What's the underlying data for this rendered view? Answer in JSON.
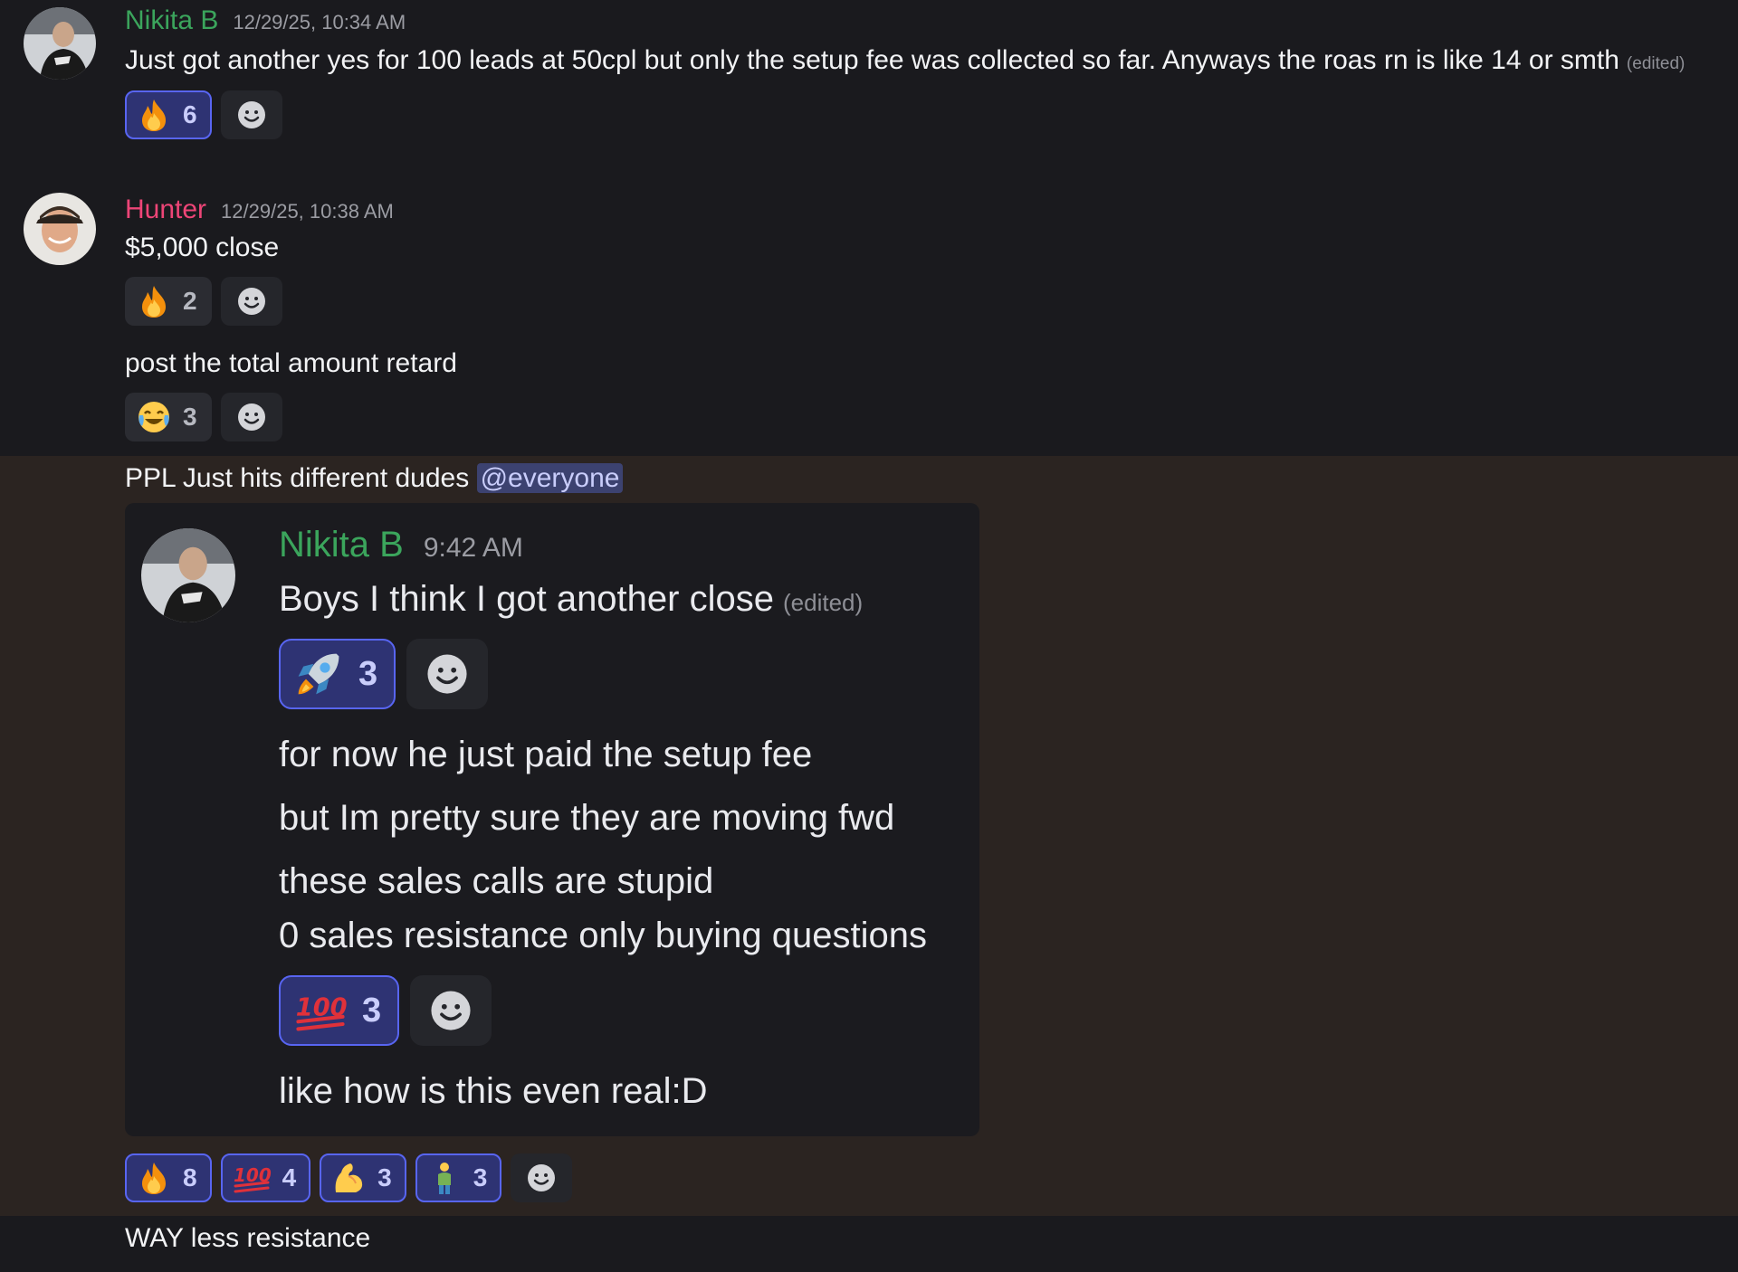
{
  "messages": [
    {
      "author": "Nikita B",
      "author_color": "#3ba55c",
      "timestamp": "12/29/25, 10:34 AM",
      "text": "Just got another yes for 100 leads at 50cpl but only the setup fee was collected so far. Anyways the roas rn is like 14 or smth",
      "edited": "(edited)",
      "reactions": [
        {
          "emoji": "fire-emoji",
          "count": "6",
          "me": true
        }
      ]
    },
    {
      "author": "Hunter",
      "author_color": "#ed4577",
      "timestamp": "12/29/25, 10:38 AM",
      "text": "$5,000 close",
      "reactions": [
        {
          "emoji": "fire-emoji",
          "count": "2",
          "me": false
        }
      ],
      "followups": [
        {
          "text": "post the total amount retard",
          "reactions": [
            {
              "emoji": "joy-emoji",
              "count": "3",
              "me": false
            }
          ]
        },
        {
          "text": "PPL Just hits different dudes",
          "mention": "@everyone",
          "embedded_screenshot": {
            "author": "Nikita B",
            "author_color": "#3ba55c",
            "timestamp": "9:42 AM",
            "line1": "Boys I think I got another close",
            "edited": "(edited)",
            "reactions1": [
              {
                "emoji": "rocket-emoji",
                "count": "3",
                "me": true
              }
            ],
            "line2": "for now he just paid the setup fee",
            "line3": "but Im pretty sure they are moving fwd",
            "line4": "these sales calls are stupid",
            "line5": "0 sales resistance only buying questions",
            "reactions2": [
              {
                "emoji": "hundred-emoji",
                "count": "3",
                "me": true
              }
            ],
            "line6": "like how is this even real:D"
          },
          "reactions": [
            {
              "emoji": "fire-emoji",
              "count": "8",
              "me": true
            },
            {
              "emoji": "hundred-emoji",
              "count": "4",
              "me": true
            },
            {
              "emoji": "flexed-biceps-emoji",
              "count": "3",
              "me": true
            },
            {
              "emoji": "person-emoji",
              "count": "3",
              "me": true
            }
          ]
        },
        {
          "text": "WAY less resistance"
        }
      ]
    }
  ]
}
